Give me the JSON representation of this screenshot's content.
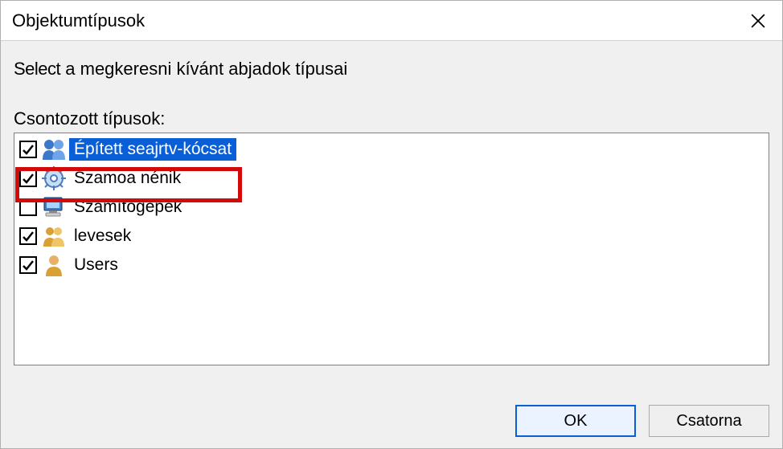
{
  "title": "Objektumtípusok",
  "prompt_select": "Select",
  "prompt_rest": " a megkeresni kívánt abjadok típusai",
  "list_label": "Csontozott típusok:",
  "items": [
    {
      "label": "Épített seajrtv-kócsat",
      "checked": true,
      "selected": true,
      "icon": "people-blue"
    },
    {
      "label": "Szamoa nénik",
      "checked": true,
      "selected": false,
      "icon": "gear",
      "boxed": true
    },
    {
      "label": "Számítógépek",
      "checked": false,
      "selected": false,
      "icon": "computer"
    },
    {
      "label": "levesek",
      "checked": true,
      "selected": false,
      "icon": "people-gold"
    },
    {
      "label": "Users",
      "checked": true,
      "selected": false,
      "icon": "person"
    }
  ],
  "buttons": {
    "ok": "OK",
    "cancel": "Csatorna"
  }
}
